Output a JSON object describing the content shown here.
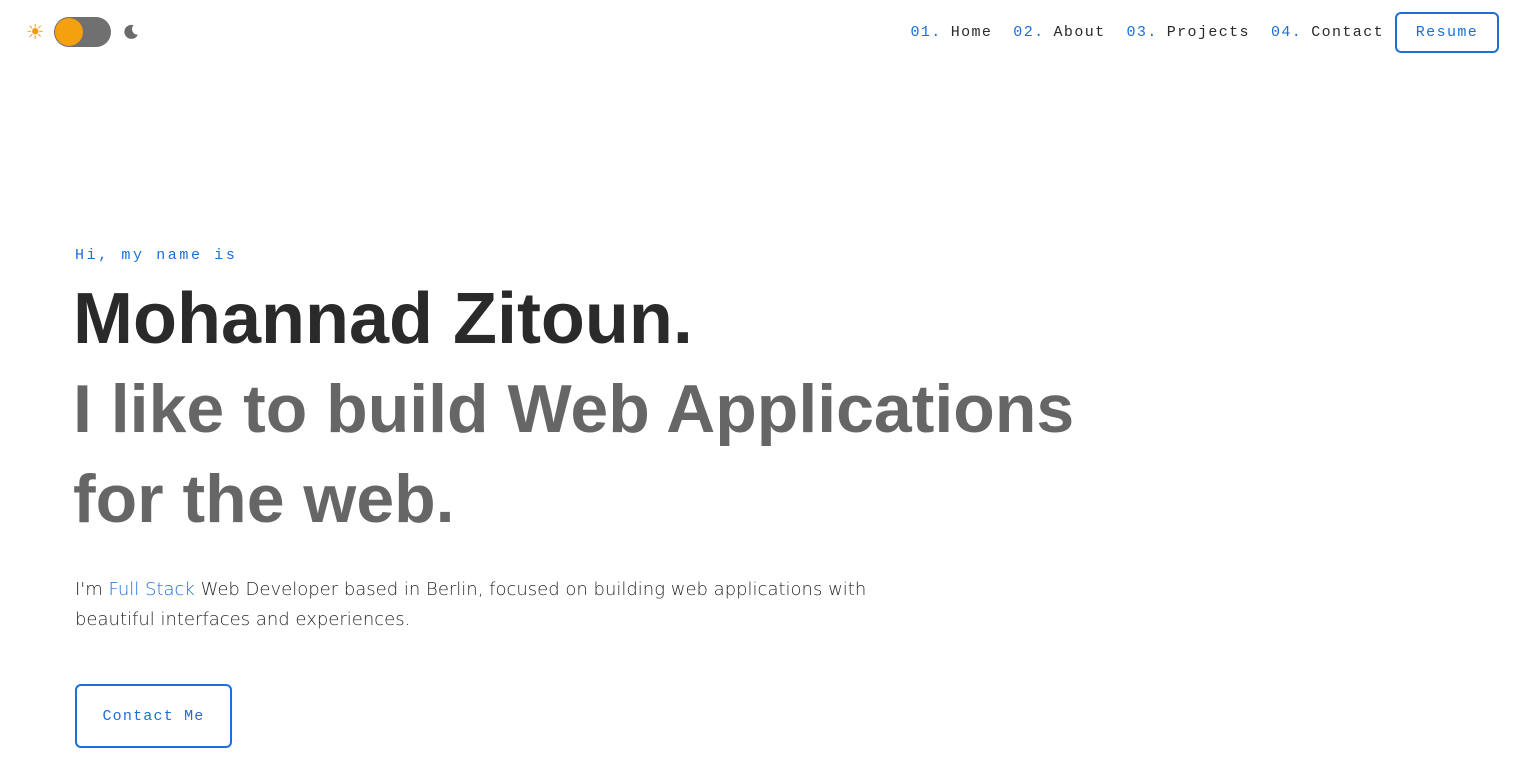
{
  "header": {
    "theme_toggle": {
      "sun_glyph": "☀",
      "sun_icon": "sun-icon",
      "moon_icon": "moon-icon",
      "mode": "light",
      "knob_color": "#f5a00f",
      "track_color": "#707070"
    },
    "nav": [
      {
        "number": "01.",
        "label": "Home"
      },
      {
        "number": "02.",
        "label": "About"
      },
      {
        "number": "03.",
        "label": "Projects"
      },
      {
        "number": "04.",
        "label": "Contact"
      }
    ],
    "resume_label": "Resume"
  },
  "hero": {
    "greeting": "Hi, my name is",
    "name": "Mohannad Zitoun.",
    "tagline": "I like to build Web Applications for the web.",
    "intro": {
      "prefix": "I'm ",
      "highlight": "Full Stack",
      "suffix": " Web Developer based in Berlin, focused on building web applications with beautiful interfaces and experiences."
    },
    "contact_label": "Contact Me"
  },
  "colors": {
    "accent": "#1a6fd8",
    "heading": "#2a2a2a",
    "subheading": "#666666",
    "sun": "#f39c12"
  }
}
